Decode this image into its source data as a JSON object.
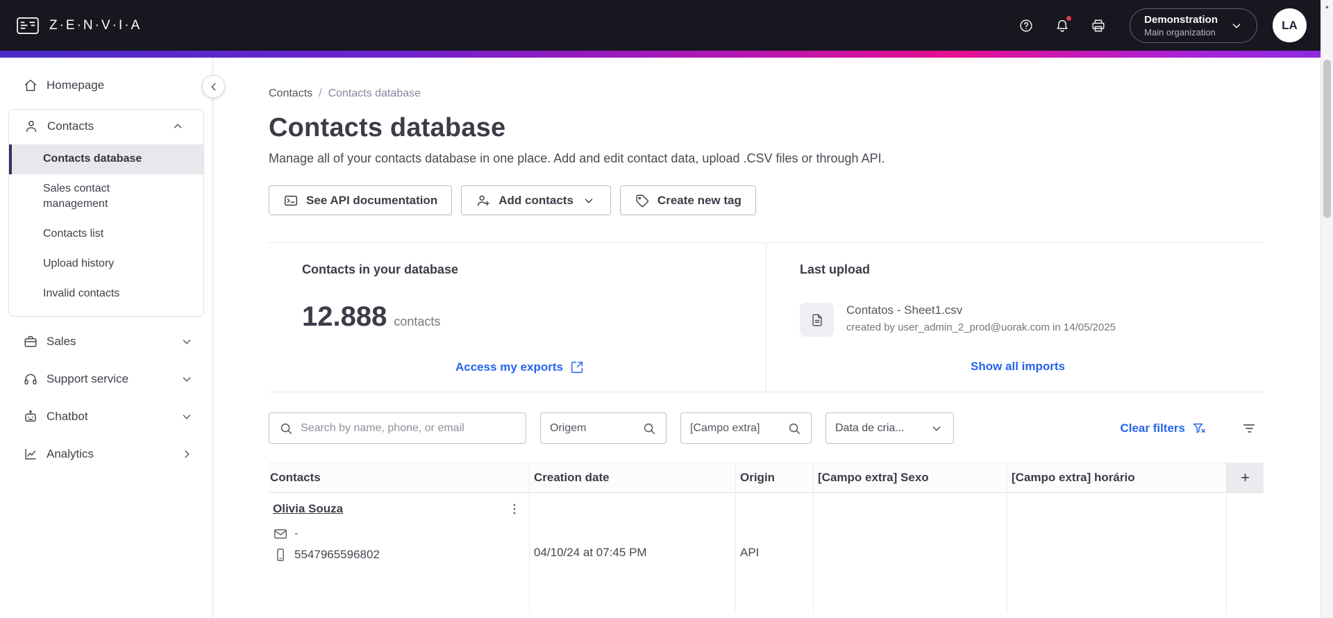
{
  "header": {
    "brand": "Z·E·N·V·I·A",
    "org": {
      "name": "Demonstration",
      "subtitle": "Main organization"
    },
    "avatar": "LA"
  },
  "sidebar": {
    "items": [
      {
        "label": "Homepage"
      },
      {
        "label": "Contacts",
        "children": [
          "Contacts database",
          "Sales contact management",
          "Contacts list",
          "Upload history",
          "Invalid contacts"
        ]
      },
      {
        "label": "Sales"
      },
      {
        "label": "Support service"
      },
      {
        "label": "Chatbot"
      },
      {
        "label": "Analytics"
      }
    ]
  },
  "breadcrumb": {
    "parent": "Contacts",
    "separator": "/",
    "current": "Contacts database"
  },
  "page": {
    "title": "Contacts database",
    "subtitle": "Manage all of your contacts database in one place. Add and edit contact data, upload .CSV files or through API."
  },
  "toolbar": {
    "api_button": "See API documentation",
    "add_contacts_button": "Add contacts",
    "create_tag_button": "Create new tag"
  },
  "summary": {
    "contacts_card": {
      "title": "Contacts in your database",
      "count": "12.888",
      "unit": "contacts",
      "link": "Access my exports"
    },
    "upload_card": {
      "title": "Last upload",
      "filename": "Contatos - Sheet1.csv",
      "meta": "created by user_admin_2_prod@uorak.com in 14/05/2025",
      "link": "Show all imports"
    }
  },
  "filters": {
    "search_placeholder": "Search by name, phone, or email",
    "origin_placeholder": "Origem",
    "extra_placeholder": "[Campo extra]",
    "date_filter": "Data de cria...",
    "clear_label": "Clear filters"
  },
  "table": {
    "headers": [
      "Contacts",
      "Creation date",
      "Origin",
      "[Campo extra] Sexo",
      "[Campo extra] horário"
    ],
    "add_column": "+",
    "rows": [
      {
        "name": "Olivia Souza",
        "email": "-",
        "phone": "5547965596802",
        "creation_date": "04/10/24 at 07:45 PM",
        "origin": "API"
      }
    ]
  },
  "colors": {
    "header_bg": "#17171f",
    "link_blue": "#2563eb",
    "active_item_bg": "#e7e7ec",
    "active_item_bar": "#35325a",
    "gradient": [
      "#4a2cc6",
      "#b217b4",
      "#e60f8e",
      "#8e2be0"
    ]
  }
}
